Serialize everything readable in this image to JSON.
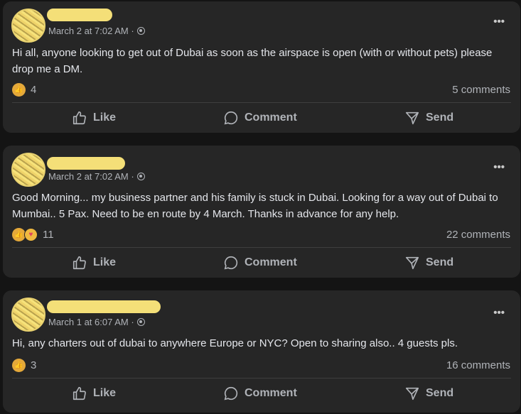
{
  "posts": [
    {
      "timestamp": "March 2 at 7:02 AM ·",
      "body": "Hi all, anyone looking to get out of Dubai as soon as the airspace is open (with or without pets) please drop me a DM.",
      "reaction_count": "4",
      "comments": "5 comments"
    },
    {
      "timestamp": "March 2 at 7:02 AM ·",
      "body": "Good Morning... my business partner and his family is stuck in Dubai. Looking for a way out of Dubai to Mumbai.. 5 Pax. Need to be en route by 4 March. Thanks in advance for any help.",
      "reaction_count": "11",
      "comments": "22 comments"
    },
    {
      "timestamp": "March 1 at 6:07 AM ·",
      "body": "Hi, any charters out of dubai to anywhere Europe or NYC? Open to sharing also.. 4 guests pls.",
      "reaction_count": "3",
      "comments": "16 comments"
    }
  ],
  "actions": {
    "like": "Like",
    "comment": "Comment",
    "send": "Send"
  },
  "more_glyph": "•••",
  "icons": {
    "like": "thumbs-up-icon",
    "comment": "speech-bubble-icon",
    "send": "paper-plane-icon",
    "privacy": "globe-icon"
  },
  "colors": {
    "card": "#262626",
    "background": "#141414",
    "text": "#e4e6eb",
    "muted": "#b0b3b8",
    "redaction": "#f4df78"
  }
}
